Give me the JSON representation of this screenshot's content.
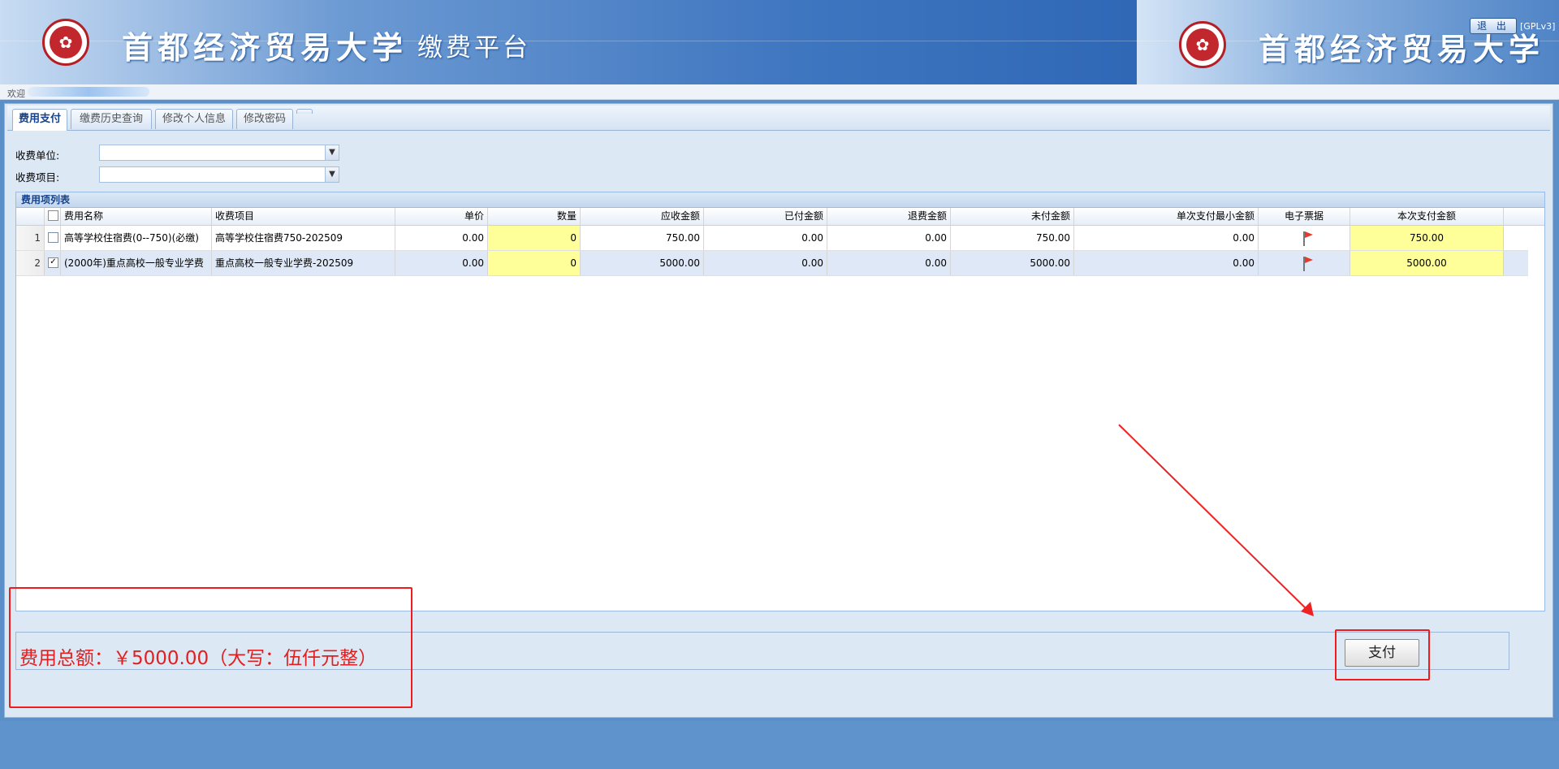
{
  "header": {
    "school_name": "首都经济贸易大学",
    "platform_name": "缴费平台",
    "school_name_repeat": "首都经济贸易大学",
    "logout_label": "退 出",
    "license_text": "[GPLv3]",
    "logo_icon": "university-seal-icon"
  },
  "welcome": {
    "text": "欢迎"
  },
  "tabs": [
    {
      "label": "费用支付",
      "active": true
    },
    {
      "label": "缴费历史查询",
      "active": false
    },
    {
      "label": "修改个人信息",
      "active": false
    },
    {
      "label": "修改密码",
      "active": false
    }
  ],
  "form": {
    "unit_label": "收费单位:",
    "unit_value": "",
    "item_label": "收费项目:",
    "item_value": ""
  },
  "grid": {
    "title": "费用项列表",
    "columns": [
      "费用名称",
      "收费项目",
      "单价",
      "数量",
      "应收金额",
      "已付金额",
      "退费金额",
      "未付金额",
      "单次支付最小金额",
      "电子票据",
      "本次支付金额"
    ],
    "rows": [
      {
        "num": "1",
        "checked": false,
        "name": "高等学校住宿费(0--750)(必缴)",
        "item": "高等学校住宿费750-202509",
        "price": "0.00",
        "qty": "0",
        "due": "750.00",
        "paid": "0.00",
        "refund": "0.00",
        "unpaid": "750.00",
        "min_pay": "0.00",
        "pay_now": "750.00"
      },
      {
        "num": "2",
        "checked": true,
        "name": "(2000年)重点高校一般专业学费",
        "item": "重点高校一般专业学费-202509",
        "price": "0.00",
        "qty": "0",
        "due": "5000.00",
        "paid": "0.00",
        "refund": "0.00",
        "unpaid": "5000.00",
        "min_pay": "0.00",
        "pay_now": "5000.00"
      }
    ]
  },
  "footer": {
    "total_text": "费用总额：￥5000.00（大写：伍仟元整）",
    "pay_label": "支付"
  },
  "colors": {
    "accent": "#15428b",
    "highlight": "#ee1c1c",
    "total_text": "#e02020",
    "editable_cell": "#ffff99"
  }
}
